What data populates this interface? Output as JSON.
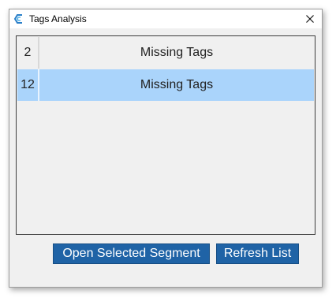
{
  "window": {
    "title": "Tags Analysis",
    "icon": "app-logo-icon",
    "close_icon": "close-icon"
  },
  "segments_list": {
    "rows": [
      {
        "number": "2",
        "label": "Missing Tags",
        "selected": false
      },
      {
        "number": "12",
        "label": "Missing Tags",
        "selected": true
      }
    ],
    "selected_color": "#aad4fb"
  },
  "buttons": {
    "open_selected_label": "Open Selected Segment",
    "refresh_label": "Refresh List",
    "color": "#1f63a6"
  }
}
